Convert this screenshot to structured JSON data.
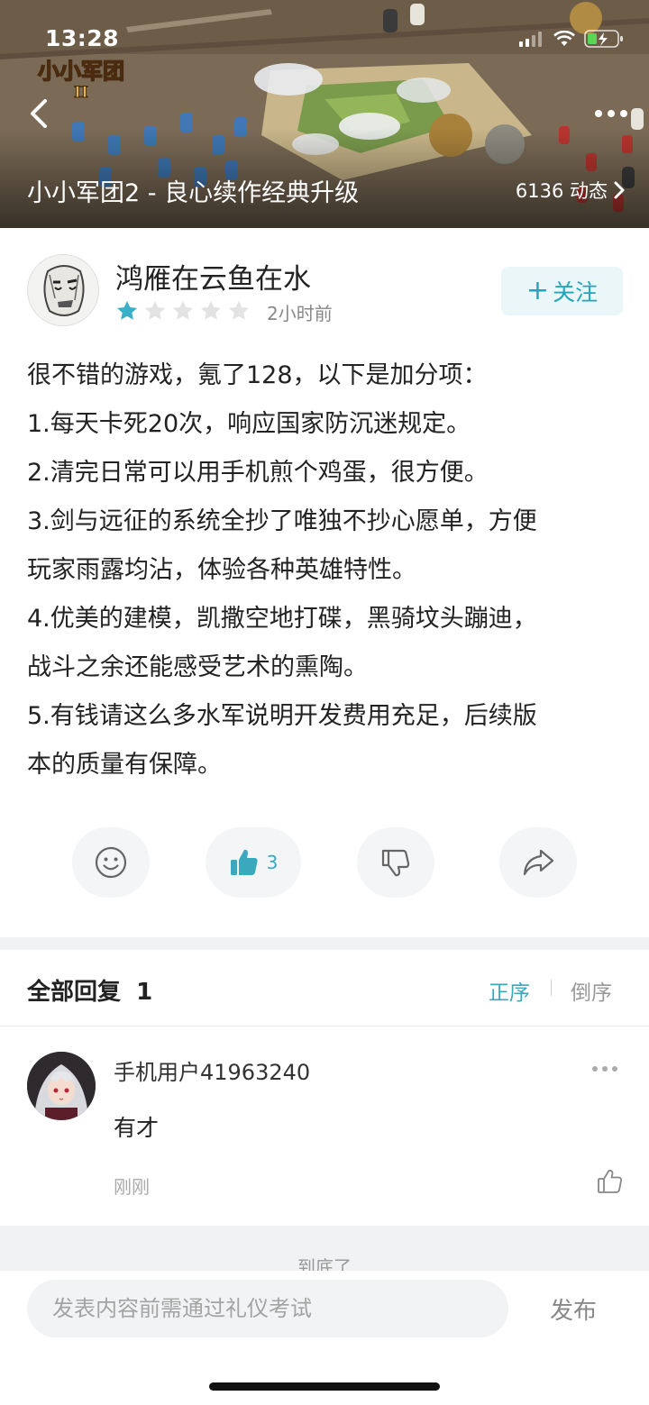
{
  "status_bar": {
    "time": "13:28"
  },
  "banner": {
    "logo_text": "小小军团",
    "logo_sub": "II",
    "title": "小小军团2 - 良心续作经典升级",
    "dynamics": "6136 动态"
  },
  "post": {
    "username": "鸿雁在云鱼在水",
    "rating": 1,
    "rating_max": 5,
    "time": "2小时前",
    "follow_label": "关注",
    "follow_plus": "+",
    "lines": [
      "很不错的游戏，氪了128，以下是加分项：",
      "1.每天卡死20次，响应国家防沉迷规定。",
      "2.清完日常可以用手机煎个鸡蛋，很方便。",
      "3.剑与远征的系统全抄了唯独不抄心愿单，方便",
      "玩家雨露均沾，体验各种英雄特性。",
      "4.优美的建模，凯撒空地打碟，黑骑坟头蹦迪，",
      "战斗之余还能感受艺术的熏陶。",
      "5.有钱请这么多水军说明开发费用充足，后续版",
      "本的质量有保障。"
    ],
    "actions": {
      "like_count": "3"
    }
  },
  "replies": {
    "title": "全部回复",
    "count": "1",
    "sort_asc": "正序",
    "sort_desc": "倒序",
    "items": [
      {
        "user": "手机用户41963240",
        "text": "有才",
        "time": "刚刚"
      }
    ],
    "end_text": "到底了"
  },
  "composer": {
    "placeholder": "发表内容前需通过礼仪考试",
    "publish_label": "发布"
  },
  "colors": {
    "accent": "#3aa9be",
    "star_filled": "#3ab0c8",
    "star_empty": "#e3e3e3",
    "follow_bg": "#eaf6f8"
  }
}
